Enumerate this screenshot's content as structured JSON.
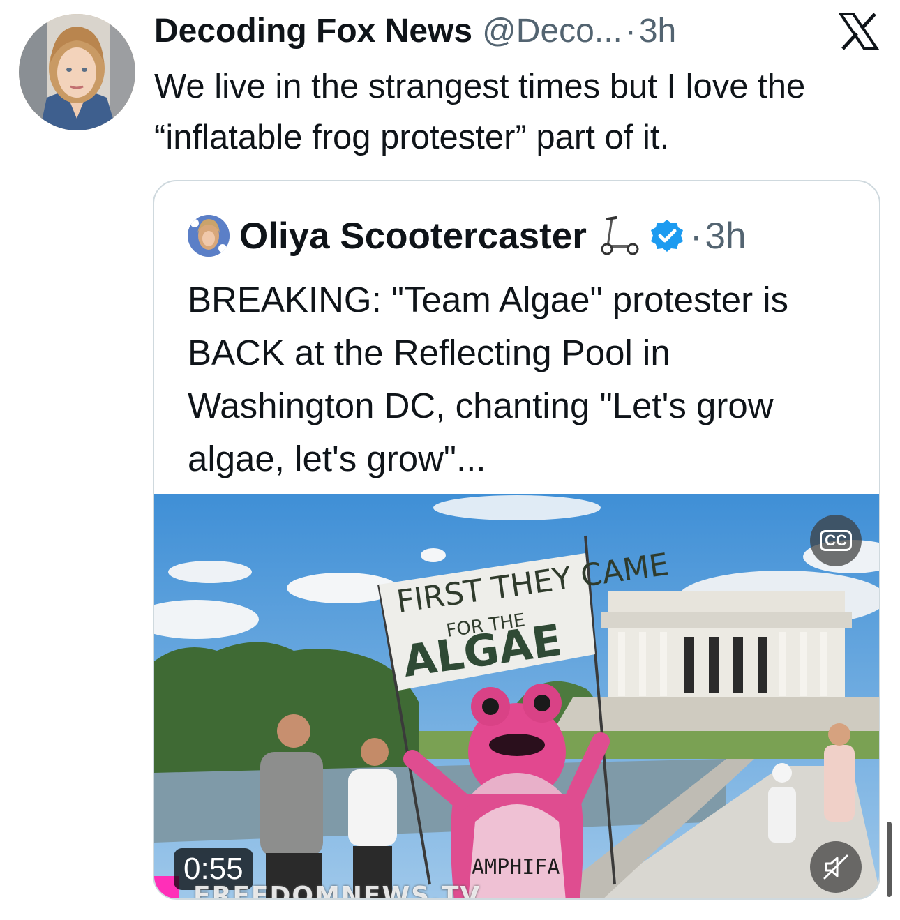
{
  "tweet": {
    "author_name": "Decoding Fox News",
    "author_handle": "@Deco...",
    "separator": "·",
    "time": "3h",
    "text": "We live in the strangest times but I love the “inflatable frog protester” part of it."
  },
  "quoted_tweet": {
    "author_name": "Oliya Scootercaster",
    "separator": "·",
    "time": "3h",
    "text": "BREAKING: \"Team Algae\" protester is BACK at the Reflecting Pool in Washington DC, chanting \"Let's grow algae, let's grow\"...",
    "video": {
      "duration": "0:55",
      "cc_label": "CC",
      "watermark": "FREEDOMNEWS.TV",
      "sign_line1": "FIRST THEY CAME",
      "sign_line2": "FOR THE",
      "sign_line3": "ALGAE",
      "frog_label": "AMPHIFA"
    }
  },
  "icons": {
    "platform": "x-logo-icon",
    "scooter": "scooter-emoji-icon",
    "verified": "verified-badge-icon",
    "captions": "closed-captions-icon",
    "mute": "muted-speaker-icon"
  },
  "colors": {
    "verified_blue": "#1d9bf0",
    "secondary_text": "#536471",
    "border": "#cfd9de"
  }
}
